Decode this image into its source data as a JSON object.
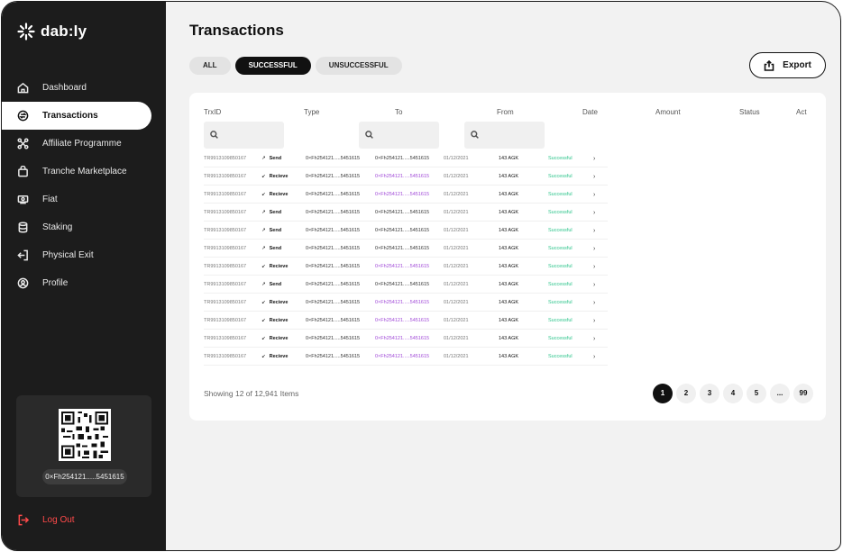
{
  "brand": {
    "name": "dab:ly"
  },
  "nav": [
    {
      "label": "Dashboard",
      "icon": "home-icon"
    },
    {
      "label": "Transactions",
      "icon": "transactions-icon",
      "active": true
    },
    {
      "label": "Affiliate Programme",
      "icon": "affiliate-icon"
    },
    {
      "label": "Tranche Marketplace",
      "icon": "bag-icon"
    },
    {
      "label": "Fiat",
      "icon": "cash-icon"
    },
    {
      "label": "Staking",
      "icon": "database-icon"
    },
    {
      "label": "Physical Exit",
      "icon": "exit-icon"
    },
    {
      "label": "Profile",
      "icon": "profile-icon"
    }
  ],
  "wallet": {
    "address": "0×Fh254121.....5451615",
    "qr_icon": "qr-code-icon"
  },
  "logout": {
    "label": "Log Out",
    "icon": "logout-icon"
  },
  "page": {
    "title": "Transactions"
  },
  "filters": [
    {
      "label": "ALL"
    },
    {
      "label": "SUCCESSFUL",
      "active": true
    },
    {
      "label": "UNSUCCESSFUL"
    }
  ],
  "export": {
    "label": "Export",
    "icon": "export-icon"
  },
  "table": {
    "headers": {
      "trx_id": "TrxID",
      "type": "Type",
      "to": "To",
      "from": "From",
      "date": "Date",
      "amount": "Amount",
      "status": "Status",
      "act": "Act"
    },
    "rows": [
      {
        "id": "TR9913109850167",
        "arrow": "↗",
        "type": "Send",
        "to": "0×Fh254121.....5451615",
        "from": "0×Fh254121.....5451615",
        "from_color": "dark",
        "date": "01/12/2021",
        "amount": "143 AGK",
        "status": "Successful"
      },
      {
        "id": "TR9913109850167",
        "arrow": "↙",
        "type": "Recieve",
        "to": "0×Fh254121.....5451615",
        "from": "0×Fh254121.....5451615",
        "from_color": "purple",
        "date": "01/12/2021",
        "amount": "143 AGK",
        "status": "Successful"
      },
      {
        "id": "TR9913109850167",
        "arrow": "↙",
        "type": "Recieve",
        "to": "0×Fh254121.....5451615",
        "from": "0×Fh254121.....5451615",
        "from_color": "purple",
        "date": "01/12/2021",
        "amount": "143 AGK",
        "status": "Successful"
      },
      {
        "id": "TR9913109850167",
        "arrow": "↗",
        "type": "Send",
        "to": "0×Fh254121.....5451615",
        "from": "0×Fh254121.....5451615",
        "from_color": "dark",
        "date": "01/12/2021",
        "amount": "143 AGK",
        "status": "Successful"
      },
      {
        "id": "TR9913109850167",
        "arrow": "↗",
        "type": "Send",
        "to": "0×Fh254121.....5451615",
        "from": "0×Fh254121.....5451615",
        "from_color": "dark",
        "date": "01/12/2021",
        "amount": "143 AGK",
        "status": "Successful"
      },
      {
        "id": "TR9913109850167",
        "arrow": "↗",
        "type": "Send",
        "to": "0×Fh254121.....5451615",
        "from": "0×Fh254121.....5451615",
        "from_color": "dark",
        "date": "01/12/2021",
        "amount": "143 AGK",
        "status": "Successful"
      },
      {
        "id": "TR9913109850167",
        "arrow": "↙",
        "type": "Recieve",
        "to": "0×Fh254121.....5451615",
        "from": "0×Fh254121.....5451615",
        "from_color": "purple",
        "date": "01/12/2021",
        "amount": "143 AGK",
        "status": "Successful"
      },
      {
        "id": "TR9913109850167",
        "arrow": "↗",
        "type": "Send",
        "to": "0×Fh254121.....5451615",
        "from": "0×Fh254121.....5451615",
        "from_color": "dark",
        "date": "01/12/2021",
        "amount": "143 AGK",
        "status": "Successful"
      },
      {
        "id": "TR9913109850167",
        "arrow": "↙",
        "type": "Recieve",
        "to": "0×Fh254121.....5451615",
        "from": "0×Fh254121.....5451615",
        "from_color": "purple",
        "date": "01/12/2021",
        "amount": "143 AGK",
        "status": "Successful"
      },
      {
        "id": "TR9913109850167",
        "arrow": "↙",
        "type": "Recieve",
        "to": "0×Fh254121.....5451615",
        "from": "0×Fh254121.....5451615",
        "from_color": "purple",
        "date": "01/12/2021",
        "amount": "143 AGK",
        "status": "Successful"
      },
      {
        "id": "TR9913109850167",
        "arrow": "↙",
        "type": "Recieve",
        "to": "0×Fh254121.....5451615",
        "from": "0×Fh254121.....5451615",
        "from_color": "purple",
        "date": "01/12/2021",
        "amount": "143 AGK",
        "status": "Successful"
      },
      {
        "id": "TR9913109850167",
        "arrow": "↙",
        "type": "Recieve",
        "to": "0×Fh254121.....5451615",
        "from": "0×Fh254121.....5451615",
        "from_color": "purple",
        "date": "01/12/2021",
        "amount": "143 AGK",
        "status": "Successful"
      }
    ],
    "row_action": "›"
  },
  "footer": {
    "showing": "Showing 12 of 12,941 Items",
    "pages": [
      "1",
      "2",
      "3",
      "4",
      "5",
      "...",
      "99"
    ],
    "current_page": "1"
  },
  "colors": {
    "sidebar": "#1c1c1c",
    "accent_purple": "#a14ad8",
    "success_green": "#2bc48a",
    "logout_red": "#ff4a4a"
  }
}
